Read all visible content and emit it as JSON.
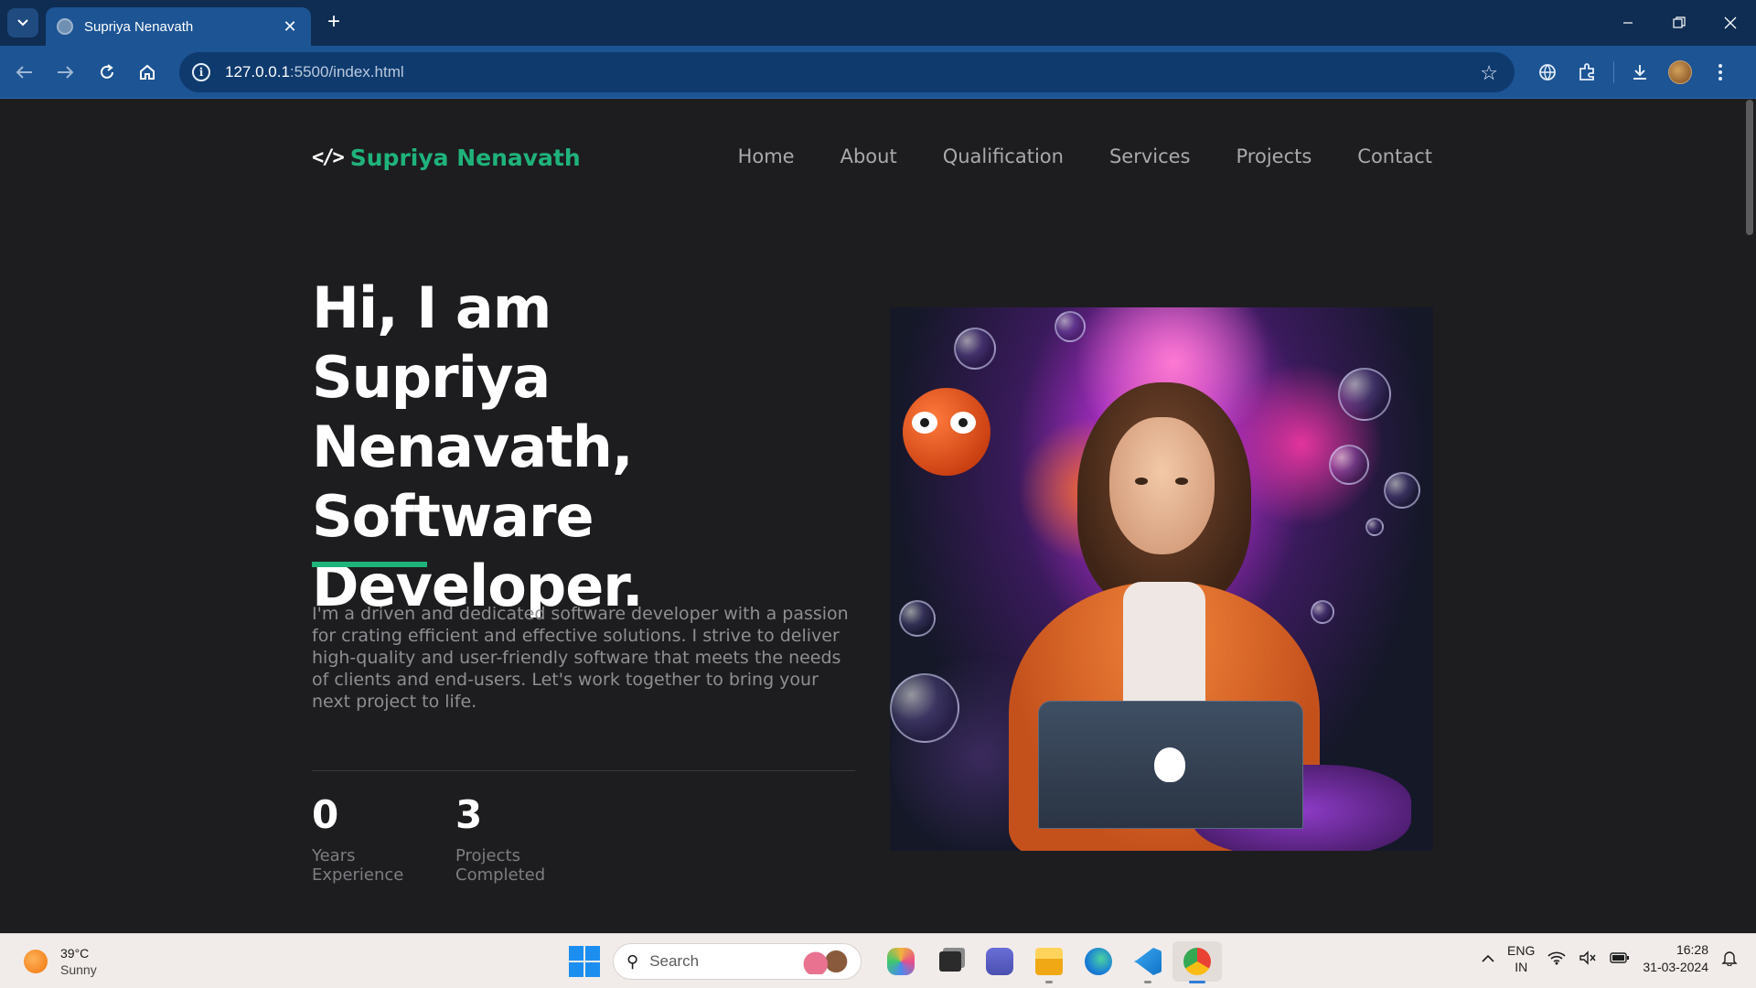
{
  "browser": {
    "tab_title": "Supriya Nenavath",
    "url_host": "127.0.0.1",
    "url_rest": ":5500/index.html"
  },
  "site": {
    "brand_icon": "</>",
    "brand_name": "Supriya Nenavath",
    "nav": [
      "Home",
      "About",
      "Qualification",
      "Services",
      "Projects",
      "Contact"
    ],
    "hero_title": "Hi, I am Supriya Nenavath, Software Developer.",
    "hero_description": "I'm a driven and dedicated software developer with a passion for crating efficient and effective solutions. I strive to deliver high-quality and user-friendly software that meets the needs of clients and end-users. Let's work together to bring your next project to life.",
    "stats": [
      {
        "value": "0",
        "label": "Years Experience"
      },
      {
        "value": "3",
        "label": "Projects Completed"
      }
    ],
    "accent_color": "#1fb37c"
  },
  "taskbar": {
    "temperature": "39°C",
    "condition": "Sunny",
    "search_placeholder": "Search",
    "lang_line1": "ENG",
    "lang_line2": "IN",
    "time": "16:28",
    "date": "31-03-2024"
  }
}
